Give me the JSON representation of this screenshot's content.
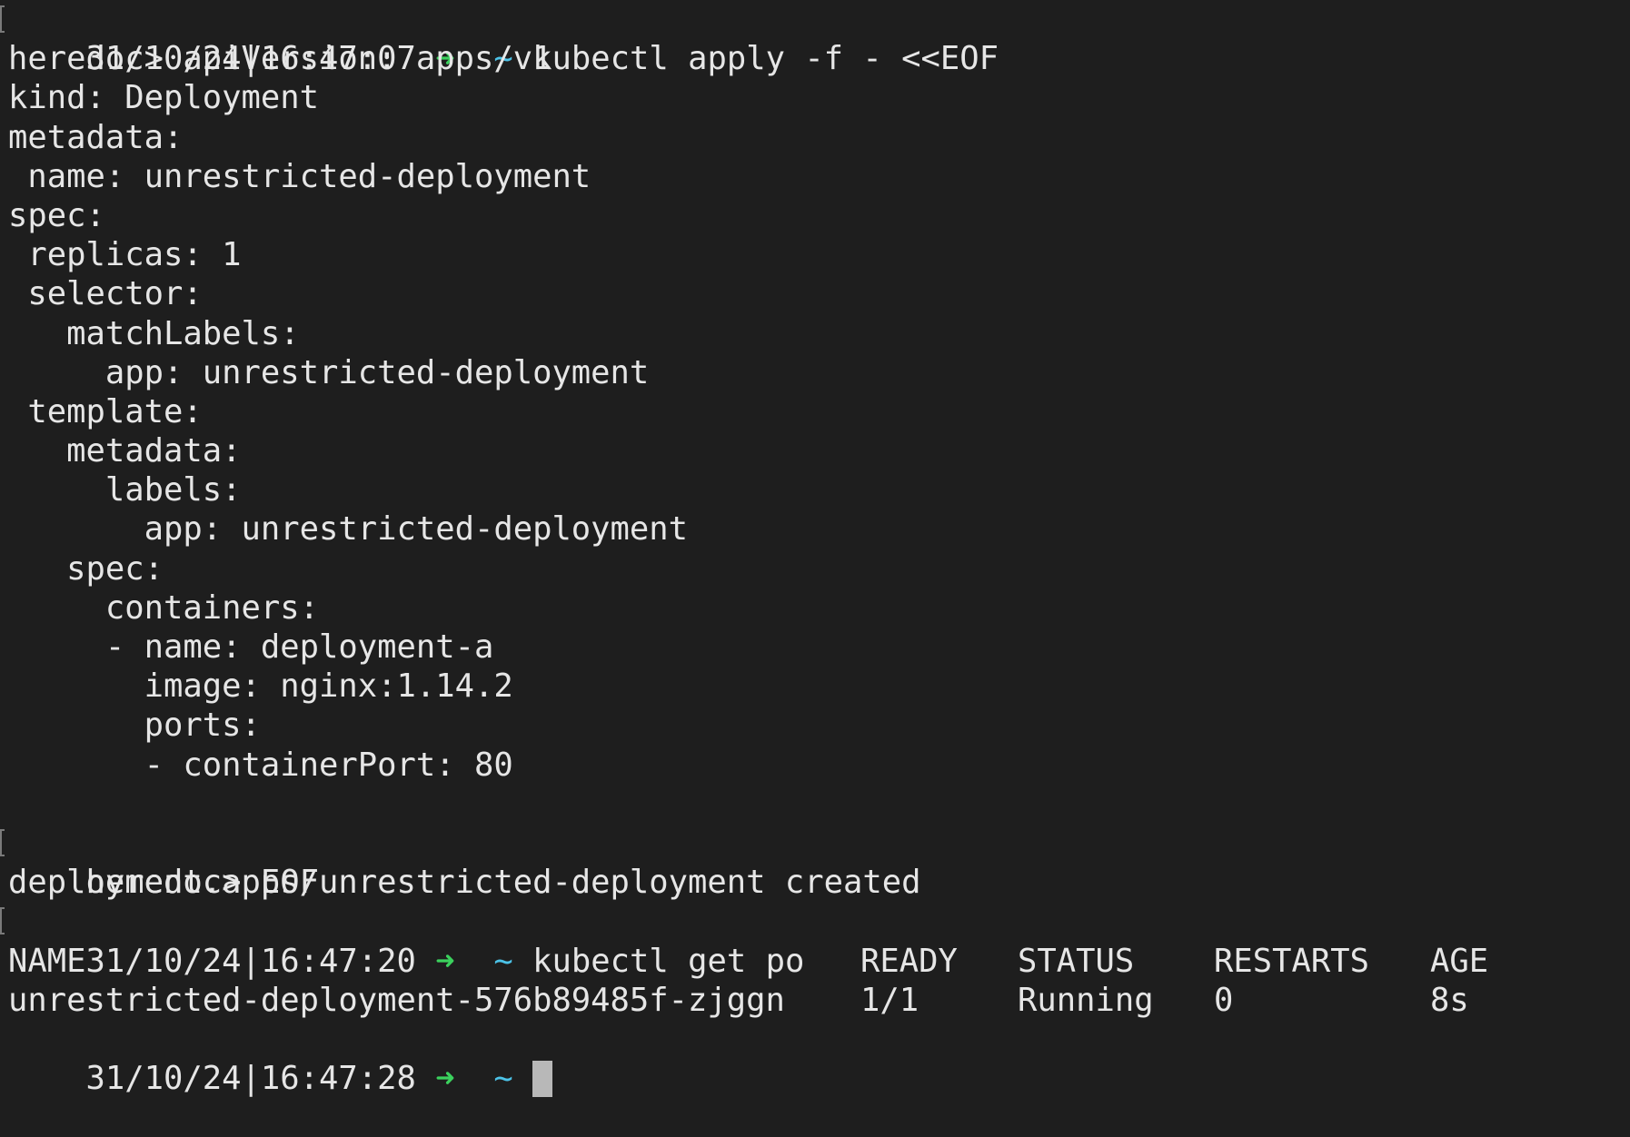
{
  "session": {
    "prompt1": {
      "timestamp": "31/10/24|16:47:07",
      "arrow": "➜",
      "dir": "~",
      "command": "kubectl apply -f - <<EOF"
    },
    "heredoc": [
      "heredoc> apiVersion: apps/v1",
      "kind: Deployment",
      "metadata:",
      " name: unrestricted-deployment",
      "spec:",
      " replicas: 1",
      " selector:",
      "   matchLabels:",
      "     app: unrestricted-deployment",
      " template:",
      "   metadata:",
      "     labels:",
      "       app: unrestricted-deployment",
      "   spec:",
      "     containers:",
      "     - name: deployment-a",
      "       image: nginx:1.14.2",
      "       ports:",
      "       - containerPort: 80",
      "",
      "heredoc> EOF"
    ],
    "apply_output": "deployment.apps/unrestricted-deployment created",
    "prompt2": {
      "timestamp": "31/10/24|16:47:20",
      "arrow": "➜",
      "dir": "~",
      "command": "kubectl get po"
    },
    "table": {
      "headers": [
        "NAME",
        "READY",
        "STATUS",
        "RESTARTS",
        "AGE"
      ],
      "rows": [
        [
          "unrestricted-deployment-576b89485f-zjggn",
          "1/1",
          "Running",
          "0",
          "8s"
        ]
      ]
    },
    "prompt3": {
      "timestamp": "31/10/24|16:47:28",
      "arrow": "➜",
      "dir": "~",
      "command": ""
    }
  },
  "colors": {
    "background": "#1e1e1e",
    "text": "#e6e6e6",
    "arrow": "#3bd15d",
    "tilde": "#4cc3e8",
    "cursor": "#b8b8b8"
  }
}
